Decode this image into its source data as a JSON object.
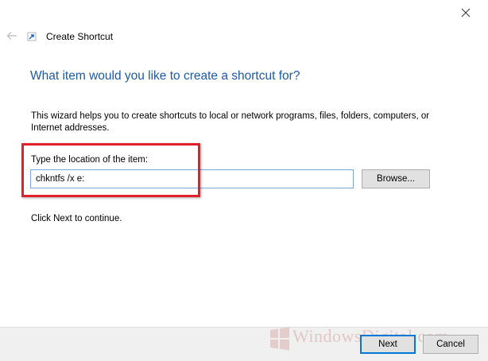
{
  "window": {
    "title": "Create Shortcut",
    "close_icon": "close-icon",
    "back_icon": "back-arrow-icon"
  },
  "wizard": {
    "heading": "What item would you like to create a shortcut for?",
    "description": "This wizard helps you to create shortcuts to local or network programs, files, folders, computers, or Internet addresses.",
    "location_label": "Type the location of the item:",
    "location_value": "chkntfs /x e:",
    "browse_label": "Browse...",
    "continue_text": "Click Next to continue."
  },
  "footer": {
    "next_label": "Next",
    "cancel_label": "Cancel"
  },
  "watermark": {
    "text": "WindowsDigital.com"
  },
  "colors": {
    "heading": "#1c5aa6",
    "highlight": "#e0202b",
    "input_border": "#7aa7d9",
    "default_button_border": "#0078d7"
  }
}
